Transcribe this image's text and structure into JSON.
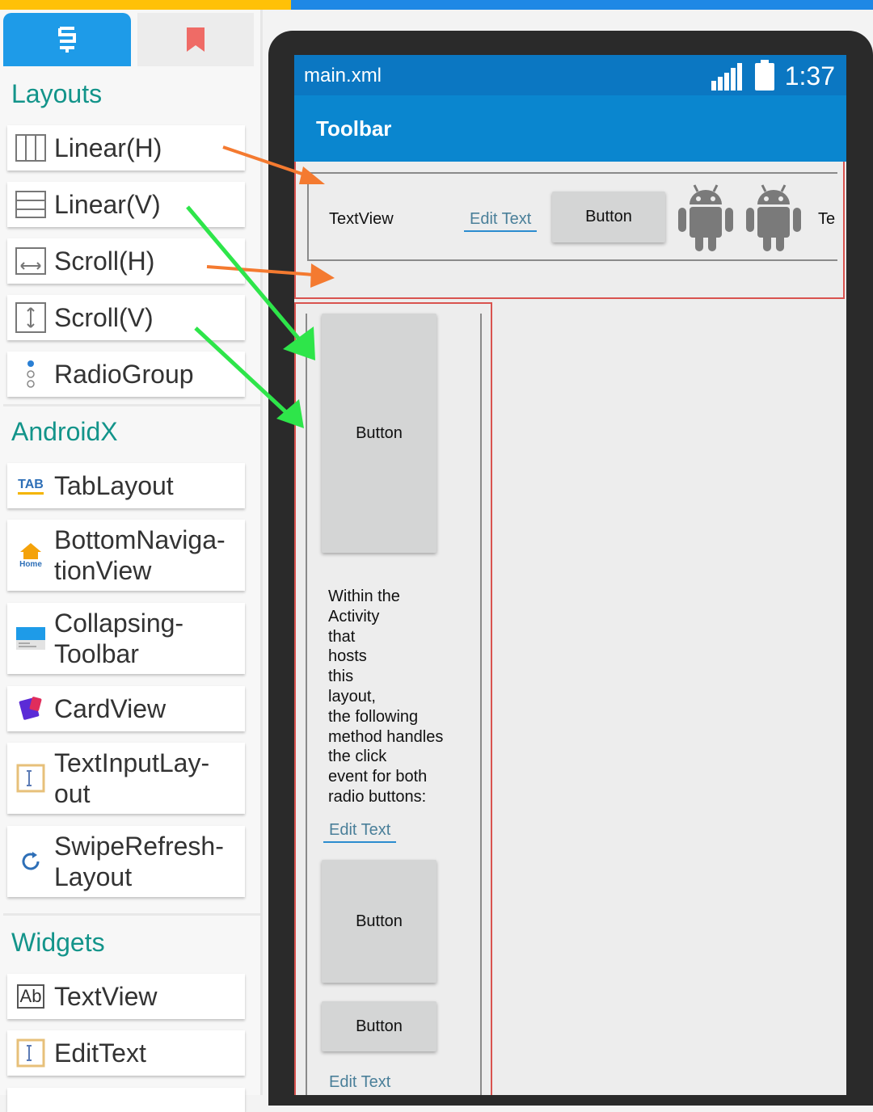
{
  "palette": {
    "tabs": [
      {
        "icon": "layers-s-icon",
        "active": true
      },
      {
        "icon": "bookmark-icon",
        "active": false
      }
    ],
    "sections": {
      "layouts": "Layouts",
      "androidx": "AndroidX",
      "widgets": "Widgets"
    },
    "layouts": [
      {
        "label": "Linear(H)",
        "icon": "linear-horizontal-icon"
      },
      {
        "label": "Linear(V)",
        "icon": "linear-vertical-icon"
      },
      {
        "label": "Scroll(H)",
        "icon": "scroll-horizontal-icon"
      },
      {
        "label": "Scroll(V)",
        "icon": "scroll-vertical-icon"
      },
      {
        "label": "RadioGroup",
        "icon": "radio-group-icon"
      }
    ],
    "androidx": [
      {
        "label": "TabLayout",
        "icon": "tab-icon"
      },
      {
        "label": "BottomNaviga-\ntionView",
        "icon": "home-icon"
      },
      {
        "label": "Collapsing-\nToolbar",
        "icon": "collapsing-toolbar-icon"
      },
      {
        "label": "CardView",
        "icon": "cardview-icon"
      },
      {
        "label": "TextInputLay-\nout",
        "icon": "text-input-icon"
      },
      {
        "label": "SwipeRefresh-\nLayout",
        "icon": "refresh-icon"
      }
    ],
    "widgets": [
      {
        "label": "TextView",
        "icon": "textview-icon"
      },
      {
        "label": "EditText",
        "icon": "edittext-icon"
      }
    ],
    "tab_label": "TAB",
    "home_label": "Home",
    "textview_icon_label": "Ab"
  },
  "preview": {
    "file_title": "main.xml",
    "time": "1:37",
    "toolbar_title": "Toolbar",
    "horizontal": {
      "textview": "TextView",
      "edittext": "Edit Text",
      "button": "Button",
      "truncated_text": "Te"
    },
    "vertical": {
      "button1": "Button",
      "paragraph": "Within the\nActivity\nthat\nhosts\nthis\nlayout,\nthe following\nmethod handles\nthe click\nevent for both\nradio buttons:",
      "edittext": "Edit Text",
      "button2": "Button",
      "button3": "Button",
      "edittext_cut": "Edit Text"
    }
  },
  "colors": {
    "accent_blue": "#1e9be8",
    "section_teal": "#13948a",
    "appbar_blue": "#0a86cf",
    "arrow_orange": "#f47a30",
    "arrow_green": "#2ee54a"
  }
}
